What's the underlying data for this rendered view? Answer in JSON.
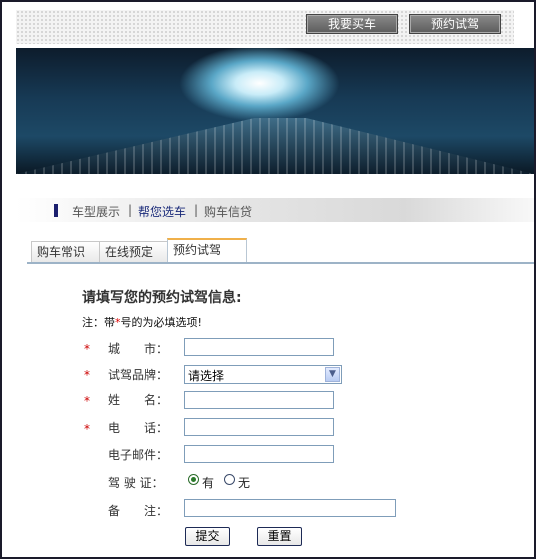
{
  "header": {
    "buy_car": "我要买车",
    "test_drive": "预约试驾"
  },
  "nav": {
    "items": [
      "车型展示",
      "帮您选车",
      "购车信贷"
    ],
    "separator": "|"
  },
  "tabs": [
    "购车常识",
    "在线预定",
    "预约试驾"
  ],
  "form": {
    "title": "请填写您的预约试驾信息:",
    "note_prefix": "注：带",
    "note_star": "*",
    "note_suffix": "号的为必填选项!",
    "required_mark": "*",
    "fields": {
      "city": "城　　市：",
      "brand": "试驾品牌：",
      "name": "姓　　名：",
      "phone": "电　　话：",
      "email": "电子邮件：",
      "license": "驾 驶 证：",
      "remark": "备　　注："
    },
    "brand_selected": "请选择",
    "license_options": [
      "有",
      "无"
    ],
    "submit": "提交",
    "reset": "重置"
  },
  "colors": {
    "accent": "#1b1f6e",
    "required": "#cc0000",
    "tab_active_top": "#f0b04a"
  }
}
